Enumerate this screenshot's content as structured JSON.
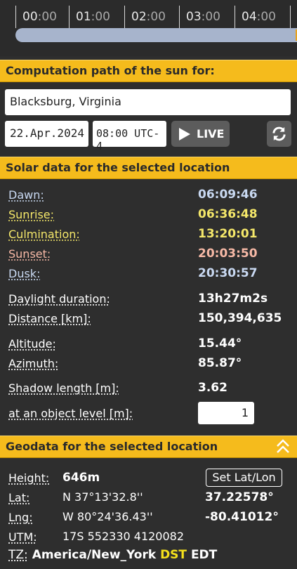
{
  "timeline": {
    "hours": [
      {
        "h": "00",
        "m": ":00"
      },
      {
        "h": "01",
        "m": ":00"
      },
      {
        "h": "02",
        "m": ":00"
      },
      {
        "h": "03",
        "m": ":00"
      },
      {
        "h": "04",
        "m": ":00"
      }
    ]
  },
  "computation": {
    "header": "Computation path of the sun for:",
    "location": "Blacksburg, Virginia",
    "date": "22.Apr.2024",
    "time": "08:00 UTC-4",
    "live_label": "LIVE"
  },
  "solar": {
    "header": "Solar data for the selected location",
    "rows": [
      {
        "label": "Dawn:",
        "value": "06:09:46",
        "label_color": "#c9d9f2",
        "value_color": "#c9d9f2"
      },
      {
        "label": "Sunrise:",
        "value": "06:36:48",
        "label_color": "#f5e86a",
        "value_color": "#f5e86a"
      },
      {
        "label": "Culmination:",
        "value": "13:20:01",
        "label_color": "#f5e86a",
        "value_color": "#f5e86a"
      },
      {
        "label": "Sunset:",
        "value": "20:03:50",
        "label_color": "#f7b9a6",
        "value_color": "#f7b9a6"
      },
      {
        "label": "Dusk:",
        "value": "20:30:57",
        "label_color": "#c9d9f2",
        "value_color": "#c9d9f2"
      }
    ],
    "daylight_label": "Daylight duration:",
    "daylight_value": "13h27m2s",
    "distance_label": "Distance [km]:",
    "distance_value": "150,394,635",
    "altitude_label": "Altitude:",
    "altitude_value": "15.44°",
    "azimuth_label": "Azimuth:",
    "azimuth_value": "85.87°",
    "shadow_label": "Shadow length [m]:",
    "shadow_value": "3.62",
    "object_level_label": "at an object level [m]:",
    "object_level_value": "1"
  },
  "geodata": {
    "header": "Geodata for the selected location",
    "height_label": "Height:",
    "height_value": "646m",
    "set_latlon_label": "Set Lat/Lon",
    "lat_label": "Lat:",
    "lat_dms": "N 37°13'32.8''",
    "lat_decimal": "37.22578°",
    "lng_label": "Lng:",
    "lng_dms": "W 80°24'36.43''",
    "lng_decimal": "-80.41012°",
    "utm_label": "UTM:",
    "utm_value": "17S 552330 4120082",
    "tz_label": "TZ:",
    "tz_value": "America/New_York",
    "tz_dst": "DST",
    "tz_abbr": "EDT"
  },
  "colors": {
    "header_bg": "#f5bb1c",
    "panel_bg": "#2e2e2e",
    "track": "#a7b4cc",
    "dst": "#f5e11c"
  }
}
